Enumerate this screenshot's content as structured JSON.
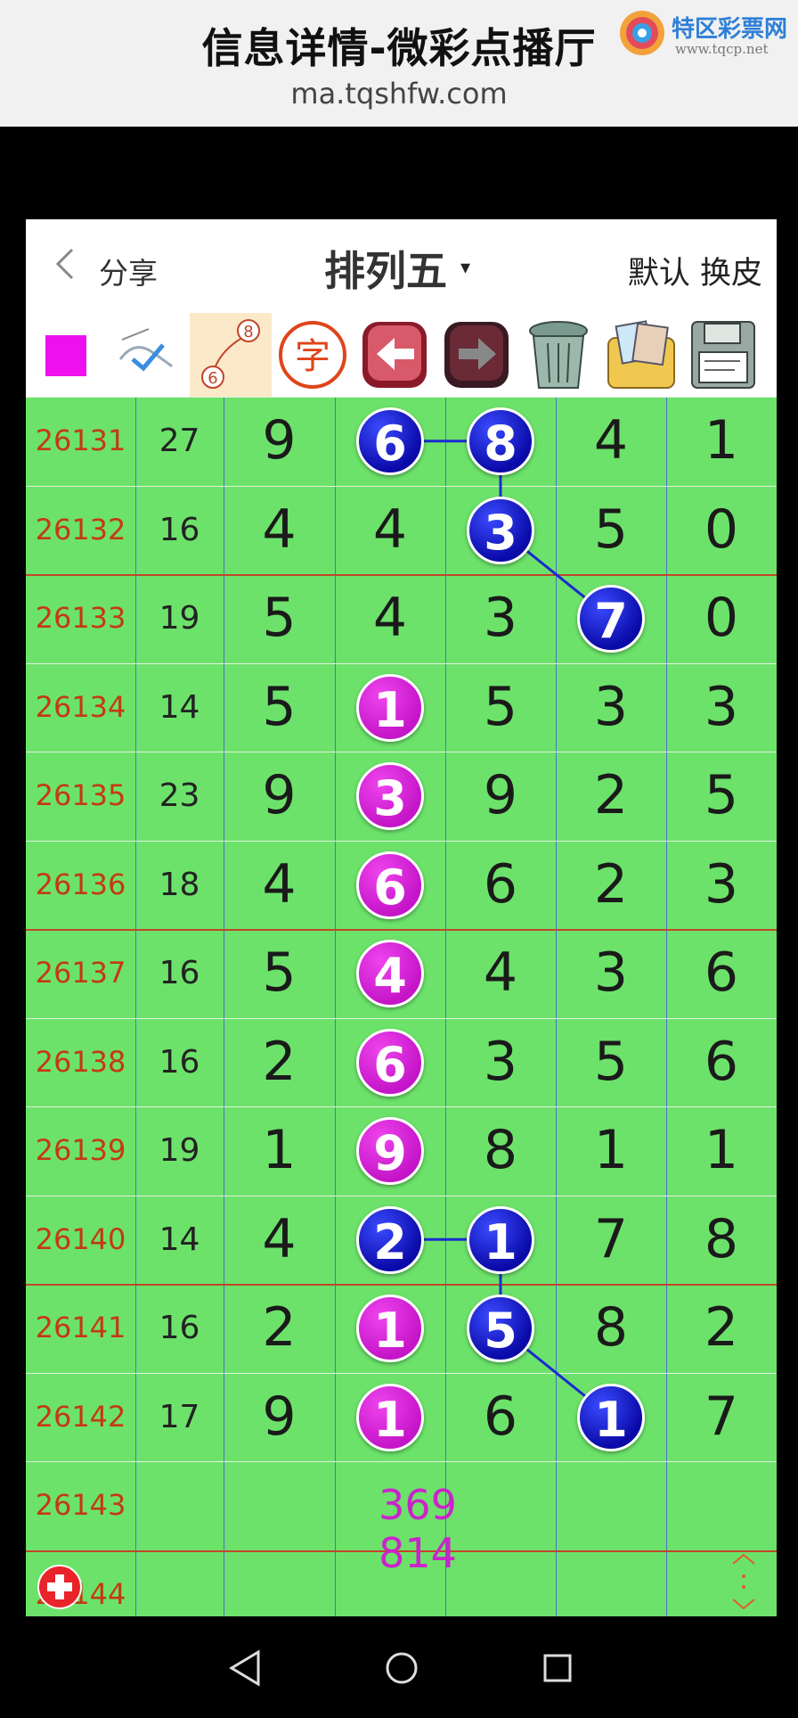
{
  "header": {
    "title": "信息详情-微彩点播厅",
    "url": "ma.tqshfw.com",
    "logo_text": "特区彩票网",
    "logo_sub": "www.tqcp.net"
  },
  "navbar": {
    "back_icon": "chevron-left-icon",
    "share_label": "分享",
    "title": "排列五",
    "caret": "▾",
    "skin_label": "默认 换皮"
  },
  "toolbar": {
    "items": [
      {
        "name": "color-swatch-icon",
        "color": "#ee11ee"
      },
      {
        "name": "draw-pen-icon"
      },
      {
        "name": "connect-line-icon",
        "label_a": "8",
        "label_b": "6"
      },
      {
        "name": "text-char-icon",
        "label": "字"
      },
      {
        "name": "arrow-left-icon"
      },
      {
        "name": "arrow-right-icon"
      },
      {
        "name": "trash-icon"
      },
      {
        "name": "photo-album-icon"
      },
      {
        "name": "floppy-save-icon"
      }
    ]
  },
  "colors": {
    "grid_bg": "#6ce26a",
    "blue_ball": "#0a0aa8",
    "magenta_ball": "#c515c8",
    "issue_text": "#c43a10"
  },
  "rows": [
    {
      "issue": "26131",
      "sum": "27",
      "digits": [
        "9",
        "6",
        "8",
        "4",
        "1"
      ],
      "balls": {
        "1": "blue",
        "2": "blue"
      }
    },
    {
      "issue": "26132",
      "sum": "16",
      "digits": [
        "4",
        "4",
        "3",
        "5",
        "0"
      ],
      "balls": {
        "2": "blue"
      }
    },
    {
      "issue": "26133",
      "sum": "19",
      "digits": [
        "5",
        "4",
        "3",
        "7",
        "0"
      ],
      "balls": {
        "3": "blue"
      }
    },
    {
      "issue": "26134",
      "sum": "14",
      "digits": [
        "5",
        "1",
        "5",
        "3",
        "3"
      ],
      "balls": {
        "1": "magenta"
      }
    },
    {
      "issue": "26135",
      "sum": "23",
      "digits": [
        "9",
        "3",
        "9",
        "2",
        "5"
      ],
      "balls": {
        "1": "magenta"
      }
    },
    {
      "issue": "26136",
      "sum": "18",
      "digits": [
        "4",
        "6",
        "6",
        "2",
        "3"
      ],
      "balls": {
        "1": "magenta"
      }
    },
    {
      "issue": "26137",
      "sum": "16",
      "digits": [
        "5",
        "4",
        "4",
        "3",
        "6"
      ],
      "balls": {
        "1": "magenta"
      }
    },
    {
      "issue": "26138",
      "sum": "16",
      "digits": [
        "2",
        "6",
        "3",
        "5",
        "6"
      ],
      "balls": {
        "1": "magenta"
      }
    },
    {
      "issue": "26139",
      "sum": "19",
      "digits": [
        "1",
        "9",
        "8",
        "1",
        "1"
      ],
      "balls": {
        "1": "magenta"
      }
    },
    {
      "issue": "26140",
      "sum": "14",
      "digits": [
        "4",
        "2",
        "1",
        "7",
        "8"
      ],
      "balls": {
        "1": "blue",
        "2": "blue"
      }
    },
    {
      "issue": "26141",
      "sum": "16",
      "digits": [
        "2",
        "1",
        "5",
        "8",
        "2"
      ],
      "balls": {
        "1": "magenta",
        "2": "blue"
      }
    },
    {
      "issue": "26142",
      "sum": "17",
      "digits": [
        "9",
        "1",
        "6",
        "1",
        "7"
      ],
      "balls": {
        "1": "magenta",
        "3": "blue"
      }
    },
    {
      "issue": "26143",
      "sum": "",
      "digits": [
        "",
        "",
        "",
        "",
        ""
      ],
      "balls": {}
    },
    {
      "issue": "26144",
      "sum": "",
      "digits": [
        "",
        "",
        "",
        "",
        ""
      ],
      "balls": {}
    }
  ],
  "links": [
    {
      "from": [
        0,
        1
      ],
      "to": [
        0,
        2
      ]
    },
    {
      "from": [
        0,
        2
      ],
      "to": [
        1,
        2
      ]
    },
    {
      "from": [
        1,
        2
      ],
      "to": [
        2,
        3
      ]
    },
    {
      "from": [
        9,
        1
      ],
      "to": [
        9,
        2
      ]
    },
    {
      "from": [
        9,
        2
      ],
      "to": [
        10,
        2
      ]
    },
    {
      "from": [
        10,
        2
      ],
      "to": [
        11,
        3
      ]
    }
  ],
  "prediction": {
    "line1": "369",
    "line2": "814"
  },
  "controls": {
    "add_icon": "add-circle-icon",
    "scroll_icon": "scroll-arrows-icon"
  },
  "system_nav": {
    "back_icon": "triangle-back-icon",
    "home_icon": "circle-home-icon",
    "recents_icon": "square-recents-icon"
  }
}
